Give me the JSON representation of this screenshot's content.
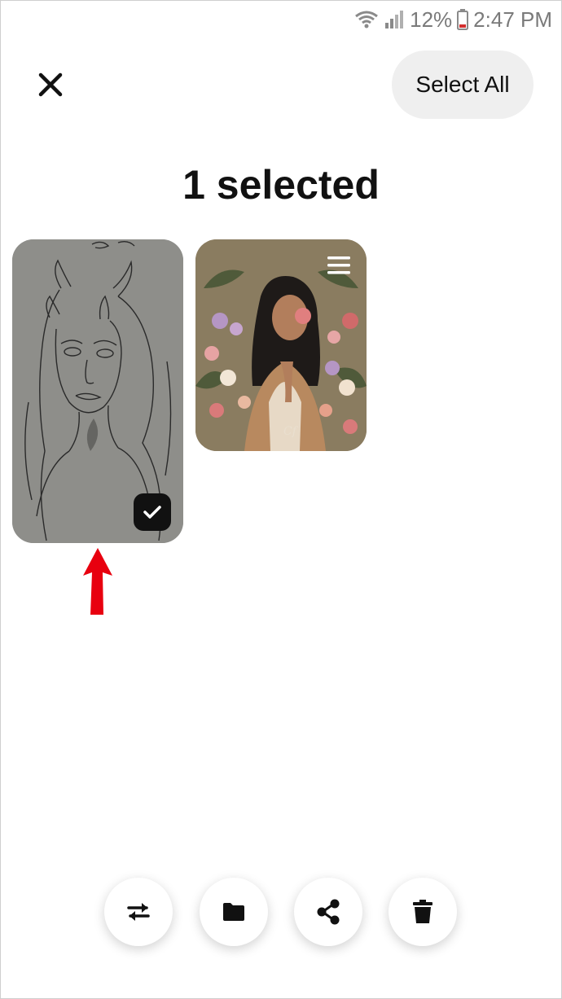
{
  "status_bar": {
    "battery_percent": "12%",
    "time": "2:47 PM",
    "icons": [
      "wifi-icon",
      "signal-icon",
      "battery-icon"
    ]
  },
  "top_bar": {
    "close_icon": "close-icon",
    "select_all_label": "Select All"
  },
  "title": "1 selected",
  "pins": [
    {
      "name": "pin-sketch-horned-girl",
      "selected": true
    },
    {
      "name": "pin-woman-flowers-illustration",
      "selected": false,
      "menu_icon": "hamburger-icon"
    }
  ],
  "annotation": {
    "icon": "arrow-up-icon",
    "color": "#e8000f"
  },
  "actions": [
    {
      "name": "move-button",
      "icon": "swap-arrows-icon"
    },
    {
      "name": "folder-button",
      "icon": "folder-icon"
    },
    {
      "name": "share-button",
      "icon": "share-icon"
    },
    {
      "name": "delete-button",
      "icon": "trash-icon"
    }
  ],
  "colors": {
    "select_all_bg": "#efefef",
    "text": "#111111",
    "arrow": "#e8000f"
  }
}
